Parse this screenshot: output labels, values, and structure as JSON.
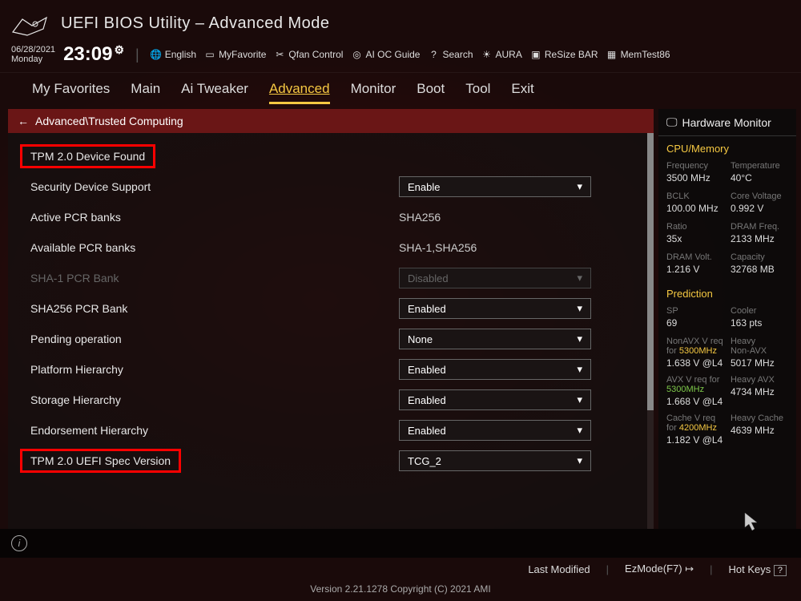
{
  "header": {
    "title": "UEFI BIOS Utility – Advanced Mode"
  },
  "datetime": {
    "date": "06/28/2021",
    "day": "Monday",
    "time": "23:09"
  },
  "toplinks": {
    "lang": "English",
    "fav": "MyFavorite",
    "qfan": "Qfan Control",
    "aioc": "AI OC Guide",
    "search": "Search",
    "aura": "AURA",
    "resize": "ReSize BAR",
    "memtest": "MemTest86"
  },
  "tabs": [
    "My Favorites",
    "Main",
    "Ai Tweaker",
    "Advanced",
    "Monitor",
    "Boot",
    "Tool",
    "Exit"
  ],
  "active_tab": "Advanced",
  "breadcrumb": "Advanced\\Trusted Computing",
  "settings": [
    {
      "label": "TPM 2.0 Device Found",
      "type": "header",
      "highlight": true
    },
    {
      "label": "Security Device Support",
      "type": "dropdown",
      "value": "Enable"
    },
    {
      "label": "Active PCR banks",
      "type": "text",
      "value": "SHA256"
    },
    {
      "label": "Available PCR banks",
      "type": "text",
      "value": "SHA-1,SHA256"
    },
    {
      "label": "SHA-1 PCR Bank",
      "type": "dropdown",
      "value": "Disabled",
      "disabled": true
    },
    {
      "label": "SHA256 PCR Bank",
      "type": "dropdown",
      "value": "Enabled"
    },
    {
      "label": "Pending operation",
      "type": "dropdown",
      "value": "None"
    },
    {
      "label": "Platform Hierarchy",
      "type": "dropdown",
      "value": "Enabled"
    },
    {
      "label": "Storage Hierarchy",
      "type": "dropdown",
      "value": "Enabled"
    },
    {
      "label": "Endorsement Hierarchy",
      "type": "dropdown",
      "value": "Enabled"
    },
    {
      "label": "TPM 2.0 UEFI Spec Version",
      "type": "dropdown",
      "value": "TCG_2",
      "highlight": true
    }
  ],
  "hw": {
    "title": "Hardware Monitor",
    "cpu_heading": "CPU/Memory",
    "cpu": [
      {
        "k": "Frequency",
        "v": "3500 MHz"
      },
      {
        "k": "Temperature",
        "v": "40°C"
      },
      {
        "k": "BCLK",
        "v": "100.00 MHz"
      },
      {
        "k": "Core Voltage",
        "v": "0.992 V"
      },
      {
        "k": "Ratio",
        "v": "35x"
      },
      {
        "k": "DRAM Freq.",
        "v": "2133 MHz"
      },
      {
        "k": "DRAM Volt.",
        "v": "1.216 V"
      },
      {
        "k": "Capacity",
        "v": "32768 MB"
      }
    ],
    "pred_heading": "Prediction",
    "pred": [
      {
        "k": "SP",
        "v": "69"
      },
      {
        "k": "Cooler",
        "v": "163 pts"
      }
    ],
    "pred2": [
      {
        "k1": "NonAVX V req",
        "k2": "for",
        "freq": "5300MHz",
        "v": "1.638 V @L4",
        "r1": "Heavy",
        "r2": "Non-AVX",
        "rv": "5017 MHz"
      },
      {
        "k1": "AVX V req",
        "k2": "for",
        "freq": "5300MHz",
        "v": "1.668 V @L4",
        "r1": "Heavy AVX",
        "r2": "",
        "rv": "4734 MHz",
        "green": true
      },
      {
        "k1": "Cache V req",
        "k2": "for",
        "freq": "4200MHz",
        "v": "1.182 V @L4",
        "r1": "Heavy Cache",
        "r2": "",
        "rv": "4639 MHz"
      }
    ]
  },
  "footer": {
    "last_modified": "Last Modified",
    "ezmode": "EzMode(F7)",
    "hotkeys": "Hot Keys",
    "version": "Version 2.21.1278 Copyright (C) 2021 AMI"
  }
}
